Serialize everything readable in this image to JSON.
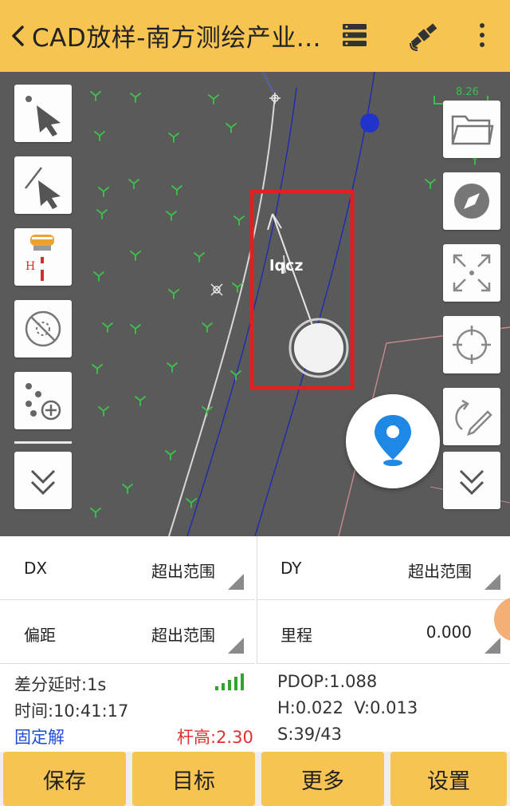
{
  "header": {
    "title": "CAD放样-南方测绘产业...",
    "icons": [
      "back-icon",
      "list-menu-icon",
      "satellite-icon",
      "more-vert-icon"
    ]
  },
  "map": {
    "scale_label": "8.26",
    "point_label": "lqcz",
    "left_tools": [
      "pointer-select-icon",
      "line-select-icon",
      "gnss-receiver-icon",
      "no-target-icon",
      "add-points-icon",
      "expand-down-icon"
    ],
    "right_tools": [
      "folder-icon",
      "compass-icon",
      "fullscreen-icon",
      "crosshair-icon",
      "rotate-edit-icon",
      "expand-down-icon"
    ],
    "colors": {
      "background": "#5a5a5a",
      "highlight_box": "#e02020",
      "locate_pin": "#1e88e5"
    }
  },
  "fields": {
    "dx": {
      "label": "DX",
      "value": "超出范围"
    },
    "dy": {
      "label": "DY",
      "value": "超出范围"
    },
    "offset": {
      "label": "偏距",
      "value": "超出范围"
    },
    "mileage": {
      "label": "里程",
      "value": "0.000"
    }
  },
  "status": {
    "diff_delay": "差分延时:1s",
    "time": "时间:10:41:17",
    "solution": "固定解",
    "pole_height": "杆高:2.30",
    "pdop": "PDOP:1.088",
    "hv": "H:0.022  V:0.013",
    "sats": "S:39/43"
  },
  "buttons": {
    "save": "保存",
    "target": "目标",
    "more": "更多",
    "settings": "设置"
  },
  "colors": {
    "accent": "#f7c452",
    "fixed_solution": "#1f4fd6",
    "pole_height": "#e03030"
  }
}
